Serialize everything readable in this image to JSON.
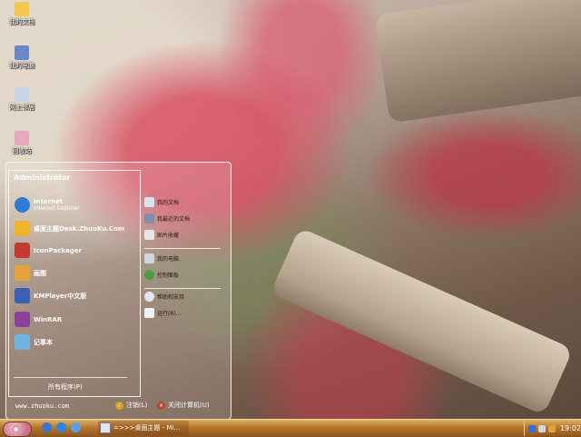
{
  "desktop": {
    "icons": [
      {
        "label": "我的文档",
        "icon": "folder-icon",
        "color": "#f2c94c"
      },
      {
        "label": "我的电脑",
        "icon": "computer-icon",
        "color": "#6a88c8"
      },
      {
        "label": "网上邻居",
        "icon": "network-icon",
        "color": "#c8d3e6"
      },
      {
        "label": "回收站",
        "icon": "recycle-bin-icon",
        "color": "#e9a9bd"
      }
    ]
  },
  "start_menu": {
    "user": "Administrator",
    "programs": [
      {
        "title": "Internet",
        "subtitle": "Internet Explorer",
        "icon": "internet-explorer-icon",
        "color": "#2e7bd6"
      },
      {
        "title": "桌面主题Desk.ZhuoKu.Com",
        "subtitle": "",
        "icon": "theme-icon",
        "color": "#f0b429"
      },
      {
        "title": "IconPackager",
        "subtitle": "",
        "icon": "iconpackager-icon",
        "color": "#c43a2e"
      },
      {
        "title": "画图",
        "subtitle": "",
        "icon": "paint-icon",
        "color": "#e8a23b"
      },
      {
        "title": "KMPlayer中文版",
        "subtitle": "",
        "icon": "kmplayer-icon",
        "color": "#3a5fb5"
      },
      {
        "title": "WinRAR",
        "subtitle": "",
        "icon": "winrar-icon",
        "color": "#8e3f9c"
      },
      {
        "title": "记事本",
        "subtitle": "",
        "icon": "notepad-icon",
        "color": "#6fb3e0"
      }
    ],
    "all_programs": "所有程序(P)",
    "right_items": [
      {
        "label": "我的文档",
        "icon": "my-documents-icon",
        "color": "#d9e3ef"
      },
      {
        "label": "我最近的文档",
        "icon": "recent-docs-icon",
        "color": "#7e8fa9"
      },
      {
        "label": "图片收藏",
        "icon": "my-pictures-icon",
        "color": "#e7e7e7"
      },
      {
        "label": "我的电脑",
        "icon": "my-computer-icon",
        "color": "#cfd6e2"
      },
      {
        "label": "控制面板",
        "icon": "control-panel-icon",
        "color": "#4c9c44"
      },
      {
        "label": "帮助和支持",
        "icon": "help-icon",
        "color": "#e0e8f6"
      },
      {
        "label": "运行(R)...",
        "icon": "run-icon",
        "color": "#eef2fa"
      }
    ],
    "website": "www.zhuoku.com",
    "logoff": "注销(L)",
    "shutdown": "关闭计算机(U)"
  },
  "taskbar": {
    "quick_launch": [
      {
        "icon": "show-desktop-icon",
        "color": "#3f74c9"
      },
      {
        "icon": "internet-explorer-icon",
        "color": "#2f86e0"
      },
      {
        "icon": "media-player-icon",
        "color": "#5aa0e6"
      }
    ],
    "task": "=>>>桌面主题 - Mi...",
    "clock": "19:02",
    "colors": {
      "bar": "#b8762c",
      "accent": "#e68aa2"
    }
  }
}
